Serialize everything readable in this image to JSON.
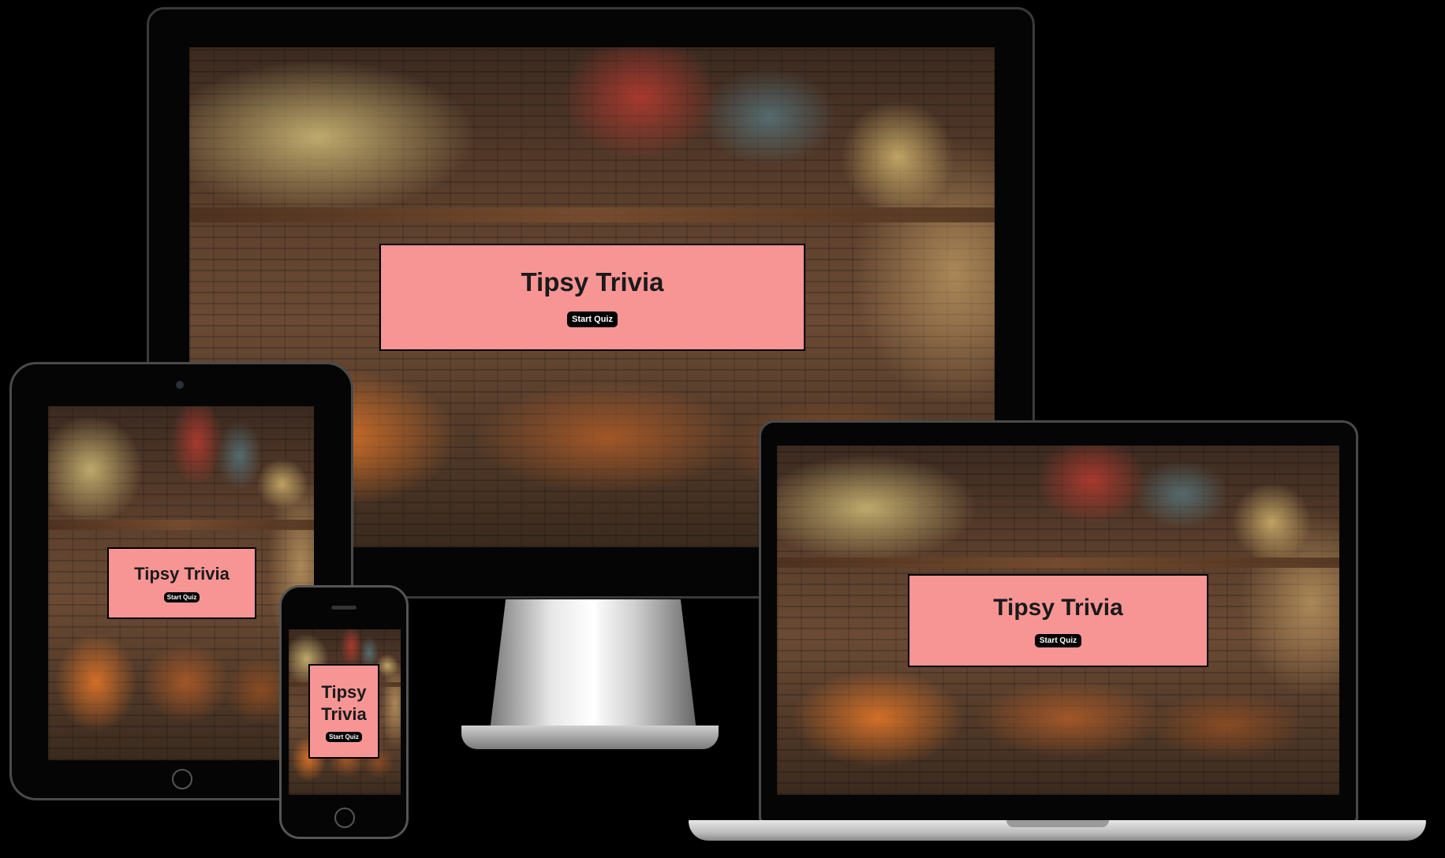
{
  "app": {
    "title": "Tipsy Trivia",
    "start_button_label": "Start Quiz",
    "colors": {
      "page_background": "#000000",
      "hero_background": "#f79595",
      "button_background": "#000000",
      "button_text": "#ffffff"
    }
  },
  "devices": {
    "monitor": {
      "title": "Tipsy Trivia",
      "start_button_label": "Start Quiz"
    },
    "tablet": {
      "title": "Tipsy Trivia",
      "start_button_label": "Start Quiz"
    },
    "phone": {
      "title_line_1": "Tipsy",
      "title_line_2": "Trivia",
      "start_button_label": "Start Quiz"
    },
    "laptop": {
      "title": "Tipsy Trivia",
      "start_button_label": "Start Quiz"
    }
  }
}
